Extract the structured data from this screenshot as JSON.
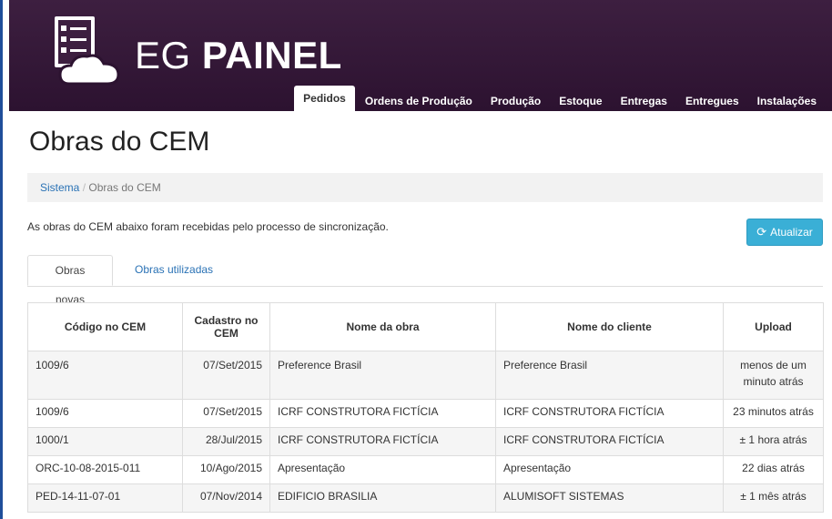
{
  "header": {
    "brand_light": "EG ",
    "brand_bold": "PAINEL",
    "nav": [
      "Pedidos",
      "Ordens de Produção",
      "Produção",
      "Estoque",
      "Entregas",
      "Entregues",
      "Instalações"
    ],
    "active_nav": "Pedidos"
  },
  "page": {
    "title": "Obras do CEM",
    "breadcrumb": {
      "root": "Sistema",
      "separator": " / ",
      "current": "Obras do CEM"
    },
    "info": "As obras do CEM abaixo foram recebidas pelo processo de sincronização.",
    "refresh_label": "Atualizar",
    "refresh_icon": "refresh-icon"
  },
  "tabs": [
    "Obras novas",
    "Obras utilizadas"
  ],
  "table": {
    "headers": [
      "Código no CEM",
      "Cadastro no CEM",
      "Nome da obra",
      "Nome do cliente",
      "Upload"
    ],
    "rows": [
      [
        "1009/6",
        "07/Set/2015",
        "Preference Brasil",
        "Preference Brasil",
        "menos de um minuto atrás"
      ],
      [
        "1009/6",
        "07/Set/2015",
        "ICRF CONSTRUTORA FICTÍCIA",
        "ICRF CONSTRUTORA FICTÍCIA",
        "23 minutos atrás"
      ],
      [
        "1000/1",
        "28/Jul/2015",
        "ICRF CONSTRUTORA FICTÍCIA",
        "ICRF CONSTRUTORA FICTÍCIA",
        "± 1 hora atrás"
      ],
      [
        "ORC-10-08-2015-011",
        "10/Ago/2015",
        "Apresentação",
        "Apresentação",
        "22 dias atrás"
      ],
      [
        "PED-14-11-07-01",
        "07/Nov/2014",
        "EDIFICIO BRASILIA",
        "ALUMISOFT SISTEMAS",
        "± 1 mês atrás"
      ]
    ]
  },
  "colors": {
    "header_bg": "#2c1230",
    "accent_button": "#3aafd6",
    "link": "#2a72b5"
  }
}
